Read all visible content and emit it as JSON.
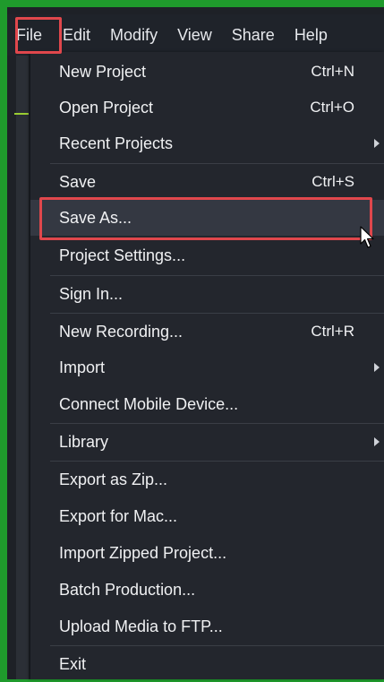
{
  "menubar": {
    "items": [
      "File",
      "Edit",
      "Modify",
      "View",
      "Share",
      "Help"
    ]
  },
  "menu": {
    "items": [
      {
        "label": "New Project",
        "shortcut": "Ctrl+N"
      },
      {
        "label": "Open Project",
        "shortcut": "Ctrl+O"
      },
      {
        "label": "Recent Projects",
        "submenu": true
      },
      {
        "label": "Save",
        "shortcut": "Ctrl+S"
      },
      {
        "label": "Save As...",
        "hovered": true
      },
      {
        "label": "Project Settings..."
      },
      {
        "label": "Sign In..."
      },
      {
        "label": "New Recording...",
        "shortcut": "Ctrl+R"
      },
      {
        "label": "Import",
        "submenu": true
      },
      {
        "label": "Connect Mobile Device..."
      },
      {
        "label": "Library",
        "submenu": true
      },
      {
        "label": "Export as Zip..."
      },
      {
        "label": "Export for Mac..."
      },
      {
        "label": "Import Zipped Project..."
      },
      {
        "label": "Batch Production..."
      },
      {
        "label": "Upload Media to FTP..."
      },
      {
        "label": "Exit"
      }
    ]
  },
  "colors": {
    "background_green": "#1f9a2c",
    "menu_background": "#23262d",
    "highlight_border": "#e0474c",
    "hover_background": "#343842"
  }
}
